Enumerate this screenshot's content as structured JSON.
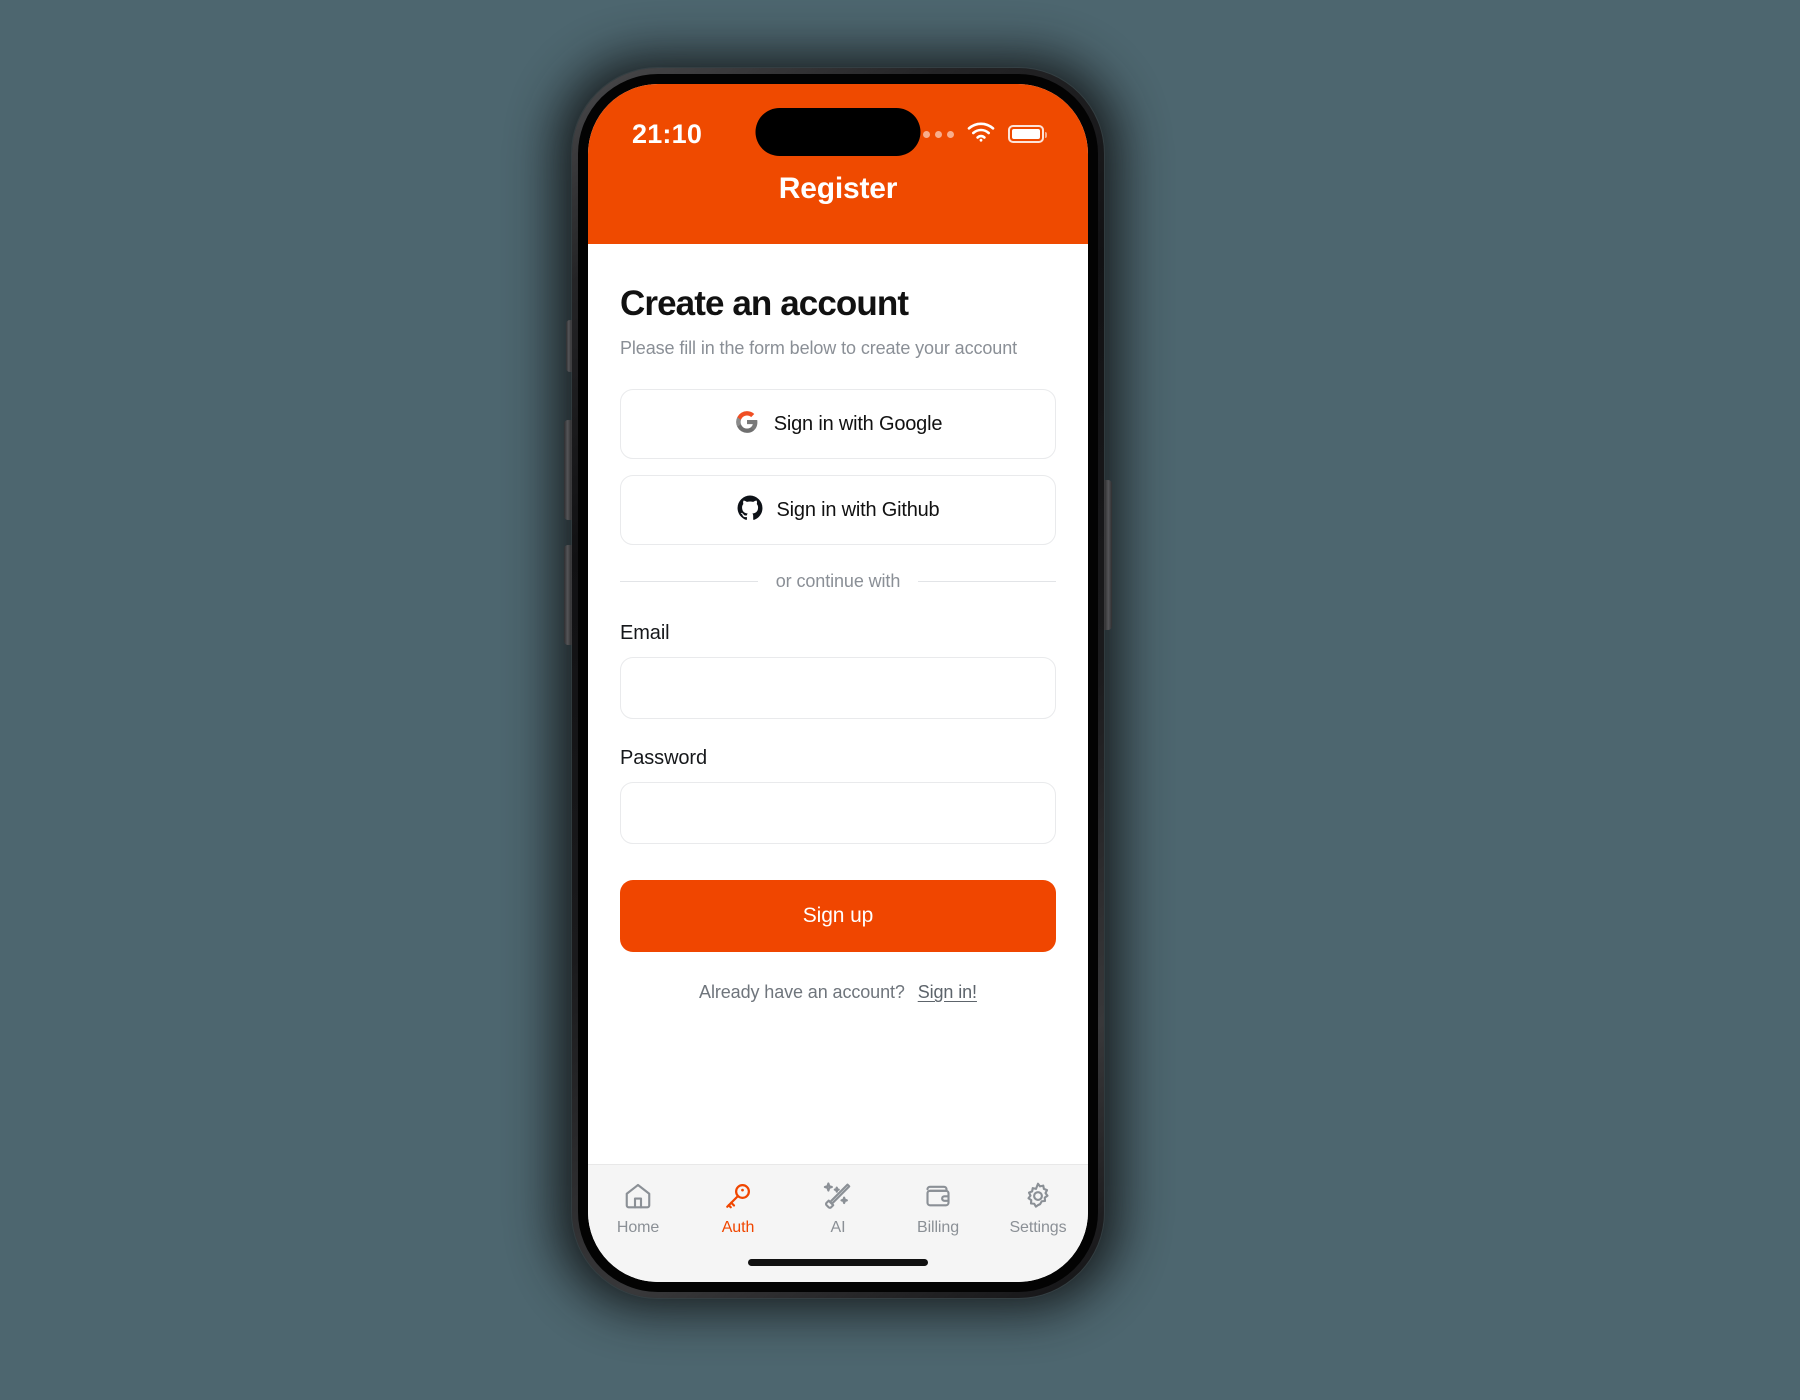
{
  "status_bar": {
    "time": "21:10",
    "cellular_icon": "cellular-dots-icon",
    "wifi_icon": "wifi-icon",
    "battery_icon": "battery-full-icon"
  },
  "header": {
    "title": "Register",
    "background_color": "#ef4a00"
  },
  "screen": {
    "heading": "Create an account",
    "subheading": "Please fill in the form below to create your account"
  },
  "oauth": {
    "google": {
      "label": "Sign in with Google",
      "icon": "google-icon"
    },
    "github": {
      "label": "Sign in with Github",
      "icon": "github-icon"
    }
  },
  "divider": {
    "label": "or continue with"
  },
  "form": {
    "email": {
      "label": "Email",
      "value": "",
      "placeholder": ""
    },
    "password": {
      "label": "Password",
      "value": "",
      "placeholder": ""
    },
    "submit": {
      "label": "Sign up",
      "color": "#f04600"
    }
  },
  "footer": {
    "prompt": "Already have an account?",
    "link": "Sign in!"
  },
  "tabbar": {
    "items": [
      {
        "label": "Home",
        "icon": "home-icon",
        "active": false
      },
      {
        "label": "Auth",
        "icon": "key-icon",
        "active": true
      },
      {
        "label": "AI",
        "icon": "magic-wand-icon",
        "active": false
      },
      {
        "label": "Billing",
        "icon": "wallet-icon",
        "active": false
      },
      {
        "label": "Settings",
        "icon": "gear-icon",
        "active": false
      }
    ],
    "active_color": "#f04600",
    "inactive_color": "#8b9096"
  }
}
